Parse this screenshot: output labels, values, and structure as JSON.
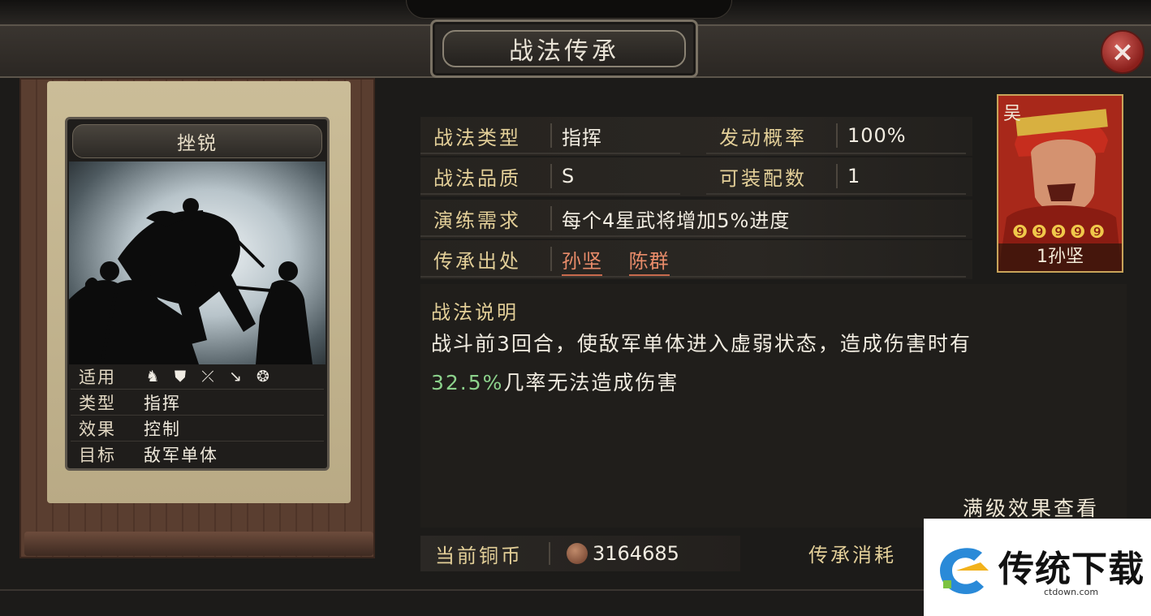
{
  "window": {
    "title": "战法传承",
    "close_label": "×"
  },
  "skill_card": {
    "name": "挫锐",
    "attrs": [
      {
        "key": "适用",
        "value": ""
      },
      {
        "key": "类型",
        "value": "指挥"
      },
      {
        "key": "效果",
        "value": "控制"
      },
      {
        "key": "目标",
        "value": "敌军单体"
      }
    ],
    "applicable_icons": [
      "cavalry-icon",
      "shield-icon",
      "bow-icon",
      "spear-icon",
      "siege-wheel-icon"
    ]
  },
  "info": {
    "type_label": "战法类型",
    "type_value": "指挥",
    "rate_label": "发动概率",
    "rate_value": "100%",
    "quality_label": "战法品质",
    "quality_value": "S",
    "equip_label": "可装配数",
    "equip_value": "1",
    "train_label": "演练需求",
    "train_value": "每个4星武将增加5%进度",
    "source_label": "传承出处",
    "sources": [
      "孙坚",
      "陈群"
    ]
  },
  "general": {
    "faction": "吴",
    "stars": "❾❾❾❾❾",
    "name": "1孙坚"
  },
  "description": {
    "title": "战法说明",
    "line1": "战斗前3回合，使敌军单体进入虚弱状态，造成伤害时有",
    "line2_highlight": "32.5%",
    "line2_rest": "几率无法造成伤害"
  },
  "full_effect_link": "满级效果查看",
  "footer": {
    "coins_label": "当前铜币",
    "coins_value": "3164685",
    "cost_label": "传承消耗"
  },
  "watermark": {
    "text": "传统下载",
    "sub": "ctdown.com"
  },
  "colors": {
    "accent_gold": "#e3cf98",
    "link_red": "#e98c6a",
    "highlight_green": "#8cd28c"
  }
}
